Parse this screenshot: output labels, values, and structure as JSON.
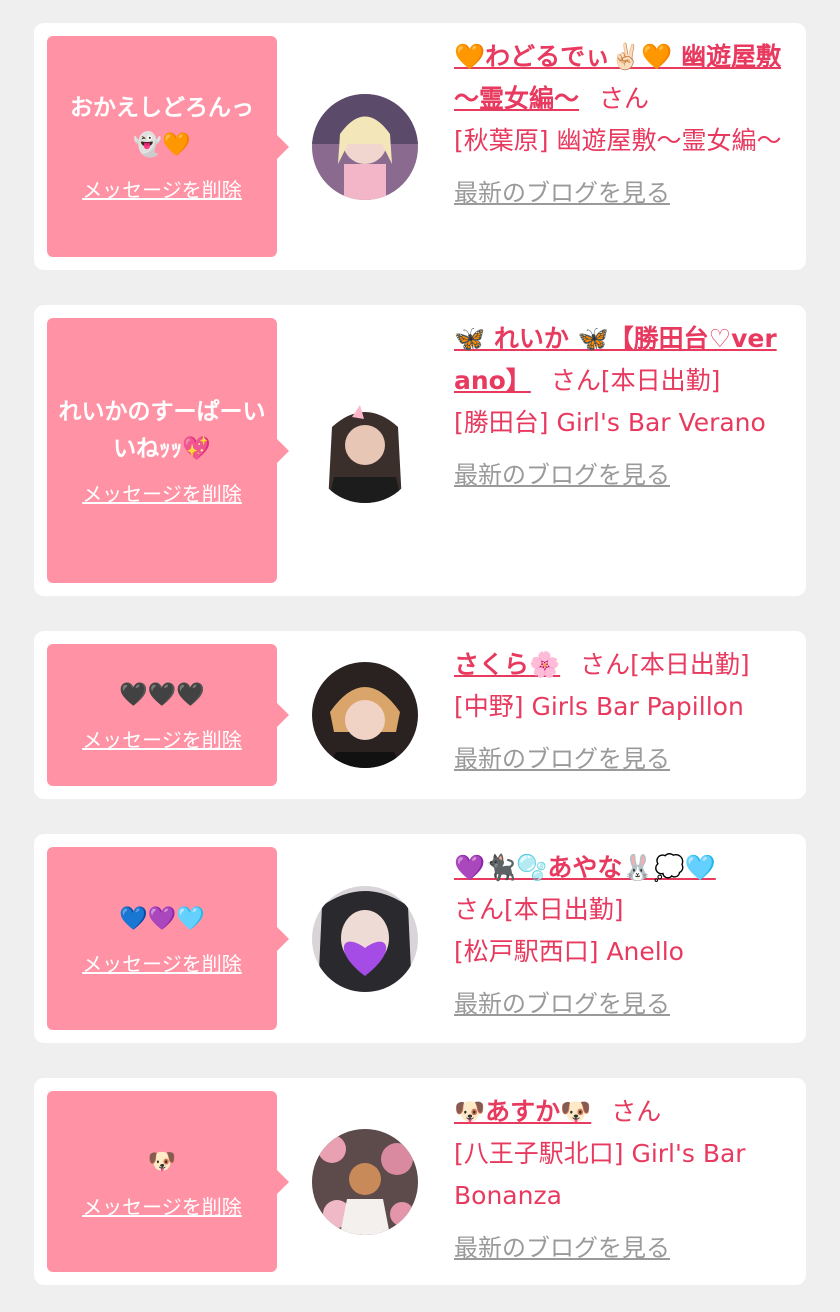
{
  "messages": [
    {
      "bubble_text": "おかえしどろんっ👻🧡",
      "delete_label": "メッセージを削除",
      "name": "🧡わどるでぃ✌🏻🧡 幽遊屋敷 〜霊女編〜",
      "san": "さん",
      "shop": "[秋葉原] 幽遊屋敷〜霊女編〜",
      "blog_label": "最新のブログを見る"
    },
    {
      "bubble_text": "れいかのすーぱーいいねｯｯ💖",
      "delete_label": "メッセージを削除",
      "name": "🦋 れいか 🦋【勝田台♡verano】",
      "san": "さん[本日出勤]",
      "shop": "[勝田台] Girl's Bar Verano",
      "blog_label": "最新のブログを見る"
    },
    {
      "bubble_text": "🖤🖤🖤",
      "delete_label": "メッセージを削除",
      "name": "さくら🌸",
      "san": "さん[本日出勤]",
      "shop": "[中野] Girls Bar Papillon",
      "blog_label": "最新のブログを見る"
    },
    {
      "bubble_text": "💙💜🩵",
      "delete_label": "メッセージを削除",
      "name": "💜🐈‍⬛🫧あやな🐰💭🩵",
      "san": "さん[本日出勤]",
      "shop": "[松戸駅西口] Anello",
      "blog_label": "最新のブログを見る"
    },
    {
      "bubble_text": "🐶",
      "delete_label": "メッセージを削除",
      "name": "🐶あすか🐶",
      "san": "さん",
      "shop": "[八王子駅北口] Girl's Bar Bonanza",
      "blog_label": "最新のブログを見る"
    }
  ],
  "colors": {
    "bubble": "#ff93a5",
    "accent": "#e8395f",
    "muted": "#9a9a9a",
    "background": "#efefef"
  }
}
